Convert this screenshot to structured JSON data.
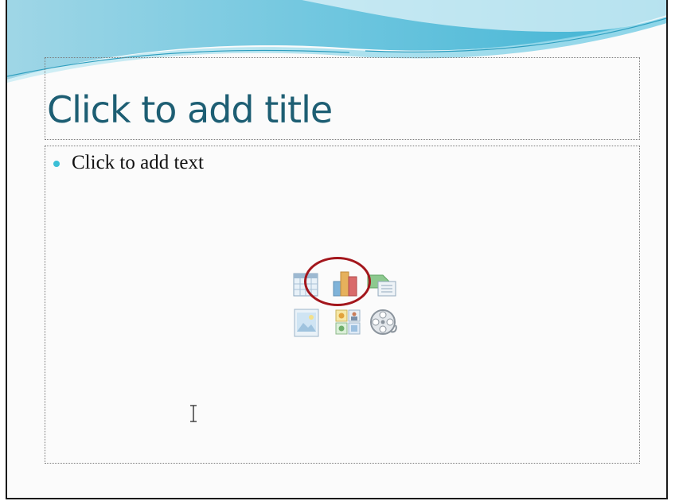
{
  "slide": {
    "title_placeholder": "Click to add title",
    "body_placeholder": "Click to add text"
  },
  "content_icons": [
    {
      "name": "insert-table-icon",
      "highlighted": true
    },
    {
      "name": "insert-chart-icon",
      "highlighted": false
    },
    {
      "name": "insert-smartart-icon",
      "highlighted": false
    },
    {
      "name": "insert-picture-icon",
      "highlighted": false
    },
    {
      "name": "insert-clipart-icon",
      "highlighted": false
    },
    {
      "name": "insert-media-icon",
      "highlighted": false
    }
  ],
  "colors": {
    "title": "#1d5e73",
    "bullet": "#3bbfd6",
    "highlight_ring": "#a3161c",
    "header_gradient_start": "#a9dbe8",
    "header_gradient_end": "#3fb3d3"
  },
  "cursor": "text-ibeam"
}
